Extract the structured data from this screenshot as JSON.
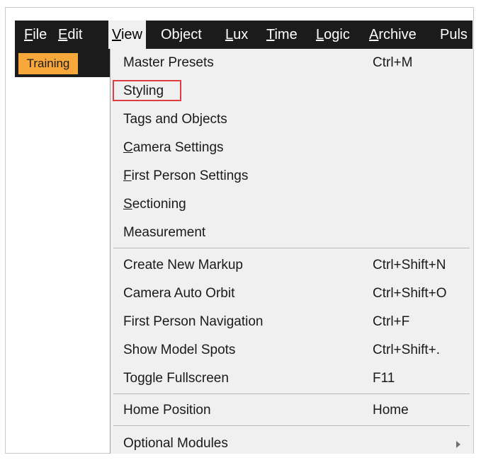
{
  "menubar": {
    "items": [
      {
        "label": "File",
        "mnemonic": "F"
      },
      {
        "label": "Edit",
        "mnemonic": "E"
      },
      {
        "label": "View",
        "mnemonic": "V"
      },
      {
        "label": "Object",
        "mnemonic": ""
      },
      {
        "label": "Lux",
        "mnemonic": "L"
      },
      {
        "label": "Time",
        "mnemonic": "T"
      },
      {
        "label": "Logic",
        "mnemonic": "L"
      },
      {
        "label": "Archive",
        "mnemonic": "A"
      },
      {
        "label": "Puls",
        "mnemonic": ""
      }
    ],
    "active": "View"
  },
  "toolbar": {
    "training_label": "Training"
  },
  "view_menu": {
    "items": [
      {
        "label": "Master Presets",
        "shortcut": "Ctrl+M"
      },
      {
        "label": "Styling",
        "shortcut": ""
      },
      {
        "label": "Tags and Objects",
        "shortcut": ""
      },
      {
        "label": "Camera Settings",
        "shortcut": ""
      },
      {
        "label": "First Person Settings",
        "shortcut": ""
      },
      {
        "label": "Sectioning",
        "shortcut": ""
      },
      {
        "label": "Measurement",
        "shortcut": ""
      },
      {
        "label": "Create New Markup",
        "shortcut": "Ctrl+Shift+N"
      },
      {
        "label": "Camera Auto Orbit",
        "shortcut": "Ctrl+Shift+O"
      },
      {
        "label": "First Person Navigation",
        "shortcut": "Ctrl+F"
      },
      {
        "label": "Show Model Spots",
        "shortcut": "Ctrl+Shift+."
      },
      {
        "label": "Toggle Fullscreen",
        "shortcut": "F11"
      },
      {
        "label": "Home Position",
        "shortcut": "Home"
      },
      {
        "label": "Optional Modules",
        "shortcut": ""
      }
    ],
    "highlighted_item": "Styling"
  },
  "colors": {
    "menubar_bg": "#1b1b1b",
    "training_tag": "#f8a73b",
    "highlight_outline": "#e03c44",
    "menu_bg": "#f0f0f0"
  }
}
